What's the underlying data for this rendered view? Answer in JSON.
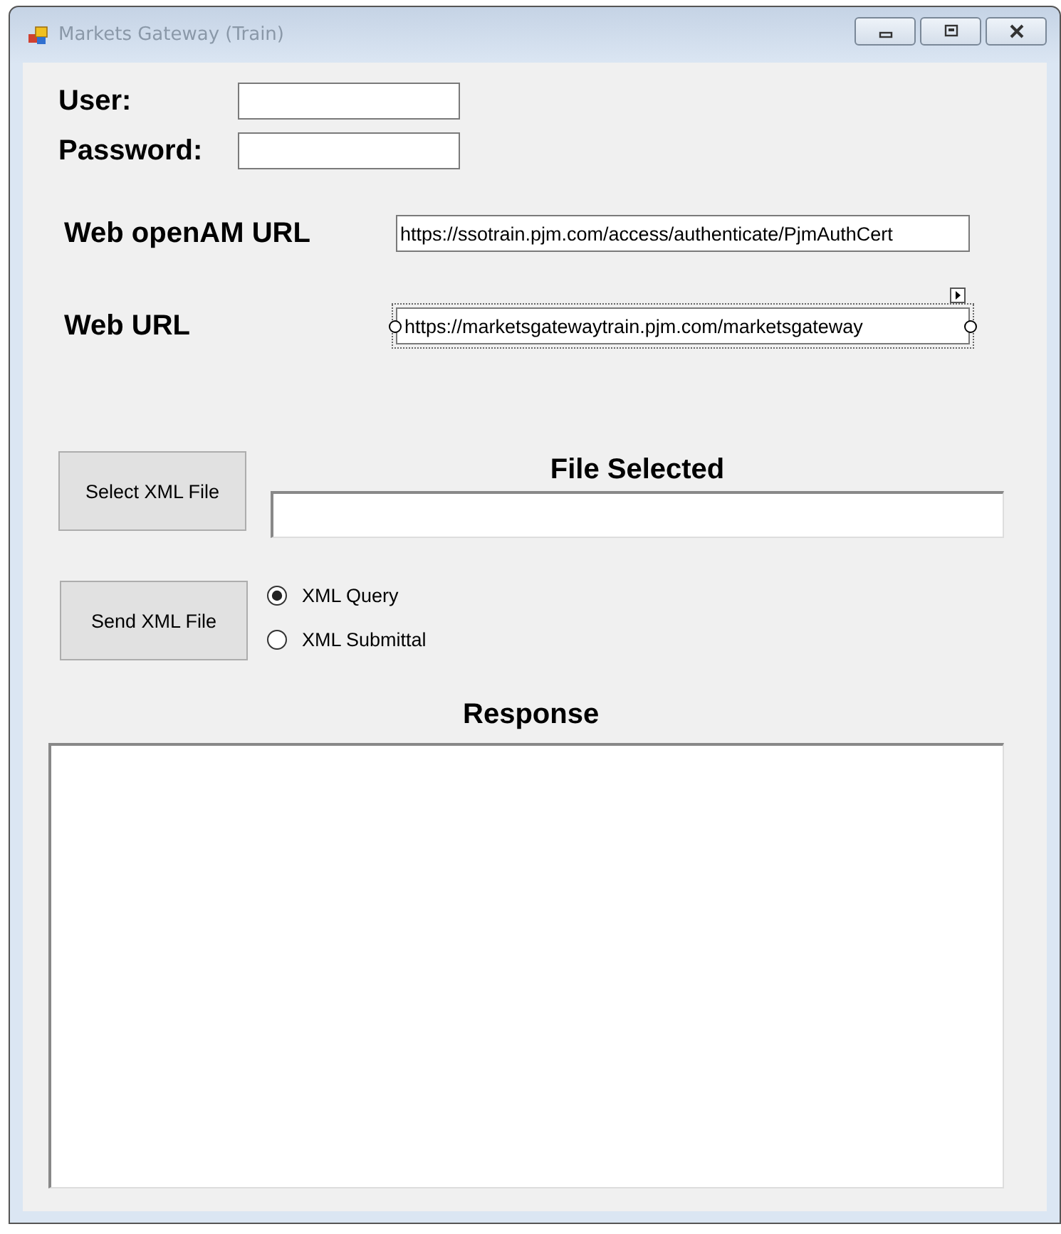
{
  "window": {
    "title": "Markets Gateway (Train)"
  },
  "login": [
    {
      "label": "User:"
    },
    {
      "label": "Password:"
    }
  ],
  "urls": [
    {
      "label": "Web openAM URL",
      "value": "https://ssotrain.pjm.com/access/authenticate/PjmAuthCert",
      "selected": false
    },
    {
      "label": "Web URL",
      "value": "https://marketsgatewaytrain.pjm.com/marketsgateway",
      "selected": true
    }
  ],
  "select_button": "Select XML File",
  "file_selected": {
    "title": "File Selected"
  },
  "send_button": "Send XML File",
  "radios": [
    {
      "label": "XML Query",
      "selected": true
    },
    {
      "label": "XML Submittal",
      "selected": false
    }
  ],
  "response": {
    "title": "Response"
  }
}
